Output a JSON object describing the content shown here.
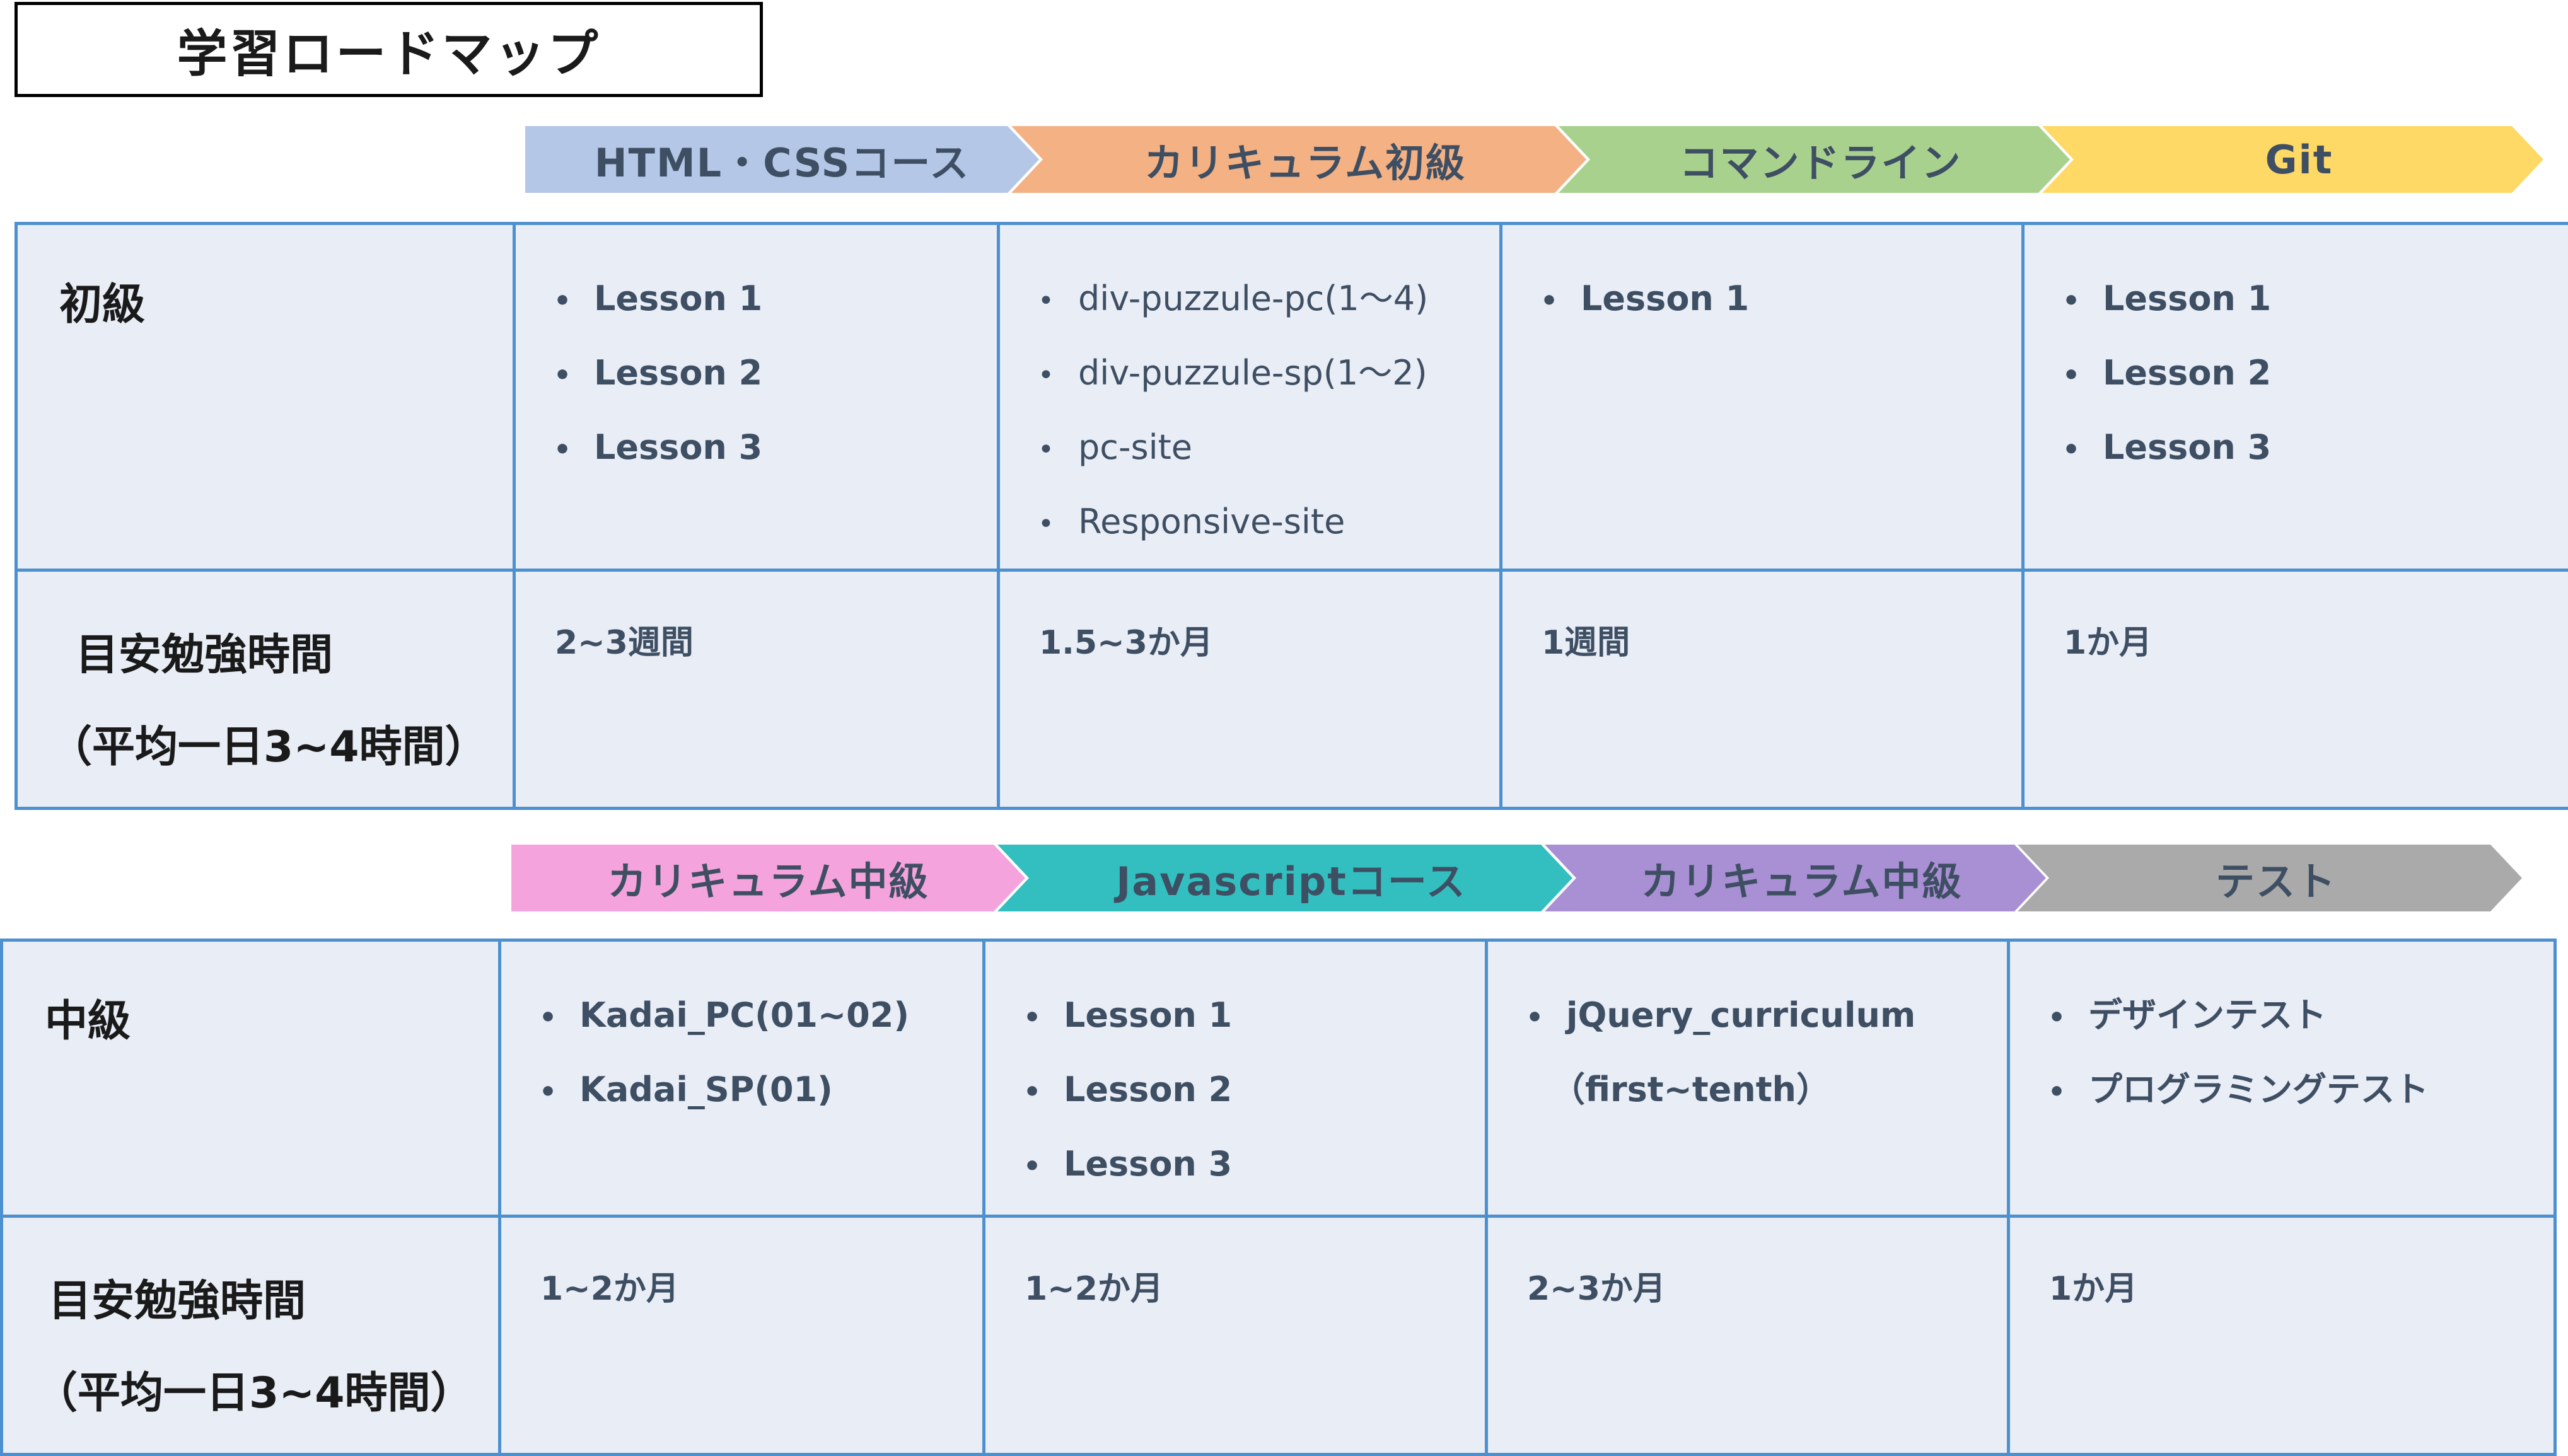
{
  "title": "学習ロードマップ",
  "colors": {
    "border": "#4d90d0",
    "cell_bg": "#e8edf6",
    "text": "#3f4f63",
    "chev_html_css": "#b4c7e7",
    "chev_beginner": "#f4b183",
    "chev_command": "#a9d18e",
    "chev_git": "#ffd966",
    "chev_mid1": "#f5a3dc",
    "chev_js": "#33bfbf",
    "chev_mid2": "#a98fd4",
    "chev_test": "#aaaaaa"
  },
  "beginner": {
    "chevrons": [
      "HTML・CSSコース",
      "カリキュラム初級",
      "コマンドライン",
      "Git"
    ],
    "level_label": "初級",
    "time_label_1": "目安勉強時間",
    "time_label_2": "（平均一日3~4時間）",
    "bullet": "•",
    "col1": [
      "Lesson 1",
      "Lesson 2",
      "Lesson 3"
    ],
    "col2": [
      "div-puzzule-pc(1〜4)",
      "div-puzzule-sp(1〜2)",
      "pc-site",
      "Responsive-site"
    ],
    "col3": [
      "Lesson 1"
    ],
    "col4": [
      "Lesson 1",
      "Lesson 2",
      "Lesson 3"
    ],
    "times": [
      "2~3週間",
      "1.5~3か月",
      "1週間",
      "1か月"
    ]
  },
  "intermediate": {
    "chevrons": [
      "カリキュラム中級",
      "Javascriptコース",
      "カリキュラム中級",
      "テスト"
    ],
    "level_label": "中級",
    "time_label_1": "目安勉強時間",
    "time_label_2": "（平均一日3~4時間）",
    "bullet": "•",
    "col1": [
      "Kadai_PC(01~02)",
      "Kadai_SP(01)"
    ],
    "col2": [
      "Lesson 1",
      "Lesson 2",
      "Lesson 3"
    ],
    "col3_item": "jQuery_curriculum",
    "col3_cont": "（first~tenth）",
    "col4": [
      "デザインテスト",
      "プログラミングテスト"
    ],
    "times": [
      "1~2か月",
      "1~2か月",
      "2~3か月",
      "1か月"
    ]
  }
}
